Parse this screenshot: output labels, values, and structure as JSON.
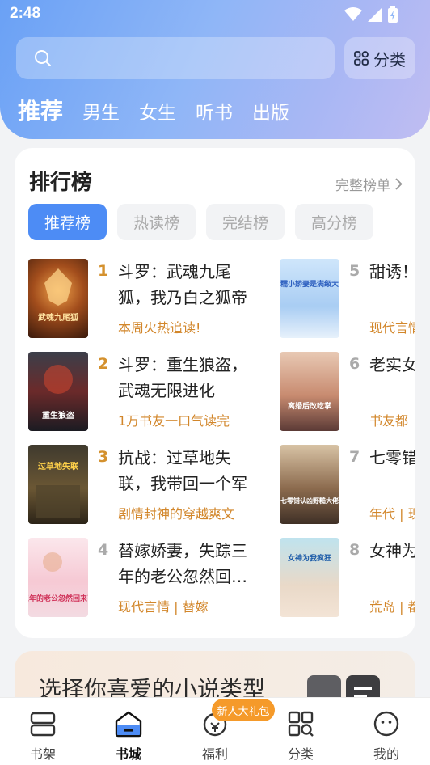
{
  "status": {
    "time": "2:48"
  },
  "search": {
    "placeholder": ""
  },
  "header": {
    "category_label": "分类"
  },
  "top_tabs": [
    {
      "label": "推荐",
      "active": true
    },
    {
      "label": "男生"
    },
    {
      "label": "女生"
    },
    {
      "label": "听书"
    },
    {
      "label": "出版"
    }
  ],
  "ranking": {
    "title": "排行榜",
    "more_label": "完整榜单",
    "subtabs": [
      {
        "label": "推荐榜",
        "active": true
      },
      {
        "label": "热读榜"
      },
      {
        "label": "完结榜"
      },
      {
        "label": "高分榜"
      }
    ],
    "books": [
      {
        "rank": "1",
        "title": "斗罗：武魂九尾狐，我乃白之狐帝",
        "tag": "本周火热追读!",
        "cover_text": "武魂九尾狐"
      },
      {
        "rank": "2",
        "title": "斗罗：重生狼盗，武魂无限进化",
        "tag": "1万书友一口气读完",
        "cover_text": "重生狼盗"
      },
      {
        "rank": "3",
        "title": "抗战：过草地失联，我带回一个军",
        "tag": "剧情封神的穿越爽文",
        "cover_text": "过草地失联"
      },
      {
        "rank": "4",
        "title": "替嫁娇妻，失踪三年的老公忽然回…",
        "tag": "现代言情 | 替嫁",
        "cover_text": "三年的老公忽然回来了"
      },
      {
        "rank": "5",
        "title": "甜诱！小娇妻",
        "tag": "现代言情",
        "cover_text": "软糯小娇妻是满级大佬"
      },
      {
        "rank": "6",
        "title": "老实女改吃掌",
        "tag": "书友都",
        "cover_text": "离婚后改吃掌"
      },
      {
        "rank": "7",
        "title": "七零错佬，南",
        "tag": "年代 | 现",
        "cover_text": "七零错认凶野糙大佬"
      },
      {
        "rank": "8",
        "title": "女神为王",
        "tag": "荒岛 | 都",
        "cover_text": "女神为我疯狂"
      }
    ],
    "rank_colors": {
      "top": "#d4912e",
      "normal": "#aaaaaa"
    }
  },
  "genre_banner": {
    "title": "选择你喜爱的小说类型"
  },
  "bottom_nav": [
    {
      "label": "书架",
      "icon": "bookshelf-icon"
    },
    {
      "label": "书城",
      "icon": "bookstore-icon",
      "active": true
    },
    {
      "label": "福利",
      "icon": "welfare-icon",
      "badge": "新人大礼包"
    },
    {
      "label": "分类",
      "icon": "category-grid-icon"
    },
    {
      "label": "我的",
      "icon": "profile-icon"
    }
  ],
  "colors": {
    "accent": "#4d8cf5",
    "tag_orange": "#d2862a",
    "badge_orange": "#f59a2a"
  }
}
